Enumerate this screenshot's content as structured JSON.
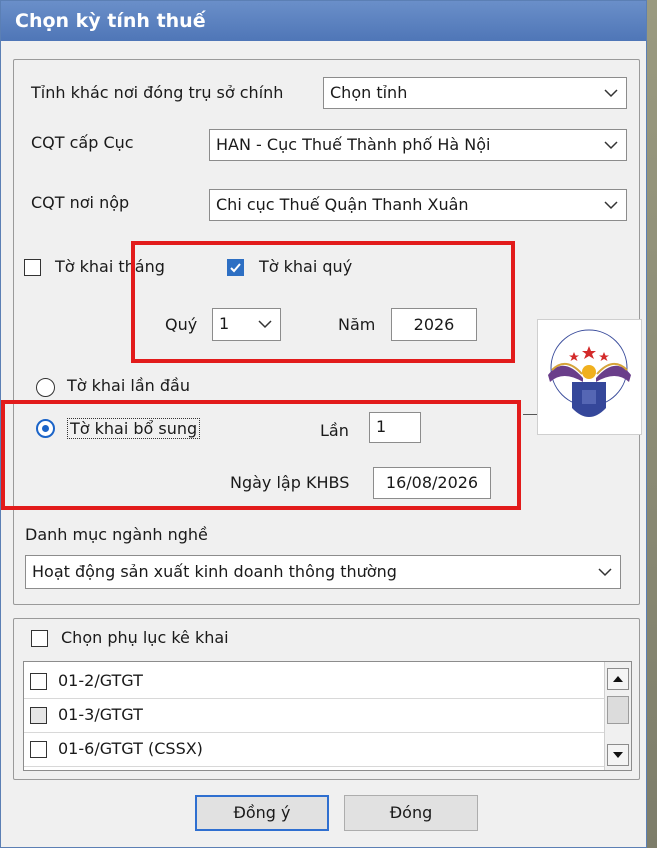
{
  "window": {
    "title": "Chọn kỳ tính thuế"
  },
  "form": {
    "province_label": "Tỉnh khác nơi đóng trụ sở chính",
    "province_value": "Chọn tỉnh",
    "dept_label": "CQT cấp Cục",
    "dept_value": "HAN - Cục Thuế Thành phố Hà Nội",
    "office_label": "CQT nơi nộp",
    "office_value": "Chi cục Thuế Quận Thanh Xuân"
  },
  "period": {
    "monthly_label": "Tờ khai tháng",
    "monthly_checked": false,
    "quarterly_label": "Tờ khai quý",
    "quarterly_checked": true,
    "quarter_label": "Quý",
    "quarter_value": "1",
    "year_label": "Năm",
    "year_value": "2026"
  },
  "declaration": {
    "first_label": "Tờ khai lần đầu",
    "supplement_label": "Tờ khai bổ sung",
    "selected": "supplement",
    "times_label": "Lần",
    "times_value": "1",
    "date_label": "Ngày lập KHBS",
    "date_value": "16/08/2026"
  },
  "industry": {
    "label": "Danh mục ngành nghề",
    "value": "Hoạt động sản xuất kinh doanh thông thường"
  },
  "appendix": {
    "label": "Chọn phụ lục kê khai",
    "items": [
      {
        "label": "01-2/GTGT"
      },
      {
        "label": "01-3/GTGT"
      },
      {
        "label": "01-6/GTGT (CSSX)"
      }
    ]
  },
  "buttons": {
    "ok": "Đồng ý",
    "close": "Đóng"
  },
  "colors": {
    "title_bar": "#4f76b7",
    "highlight": "#e21b1b",
    "accent": "#2d6fc3"
  }
}
